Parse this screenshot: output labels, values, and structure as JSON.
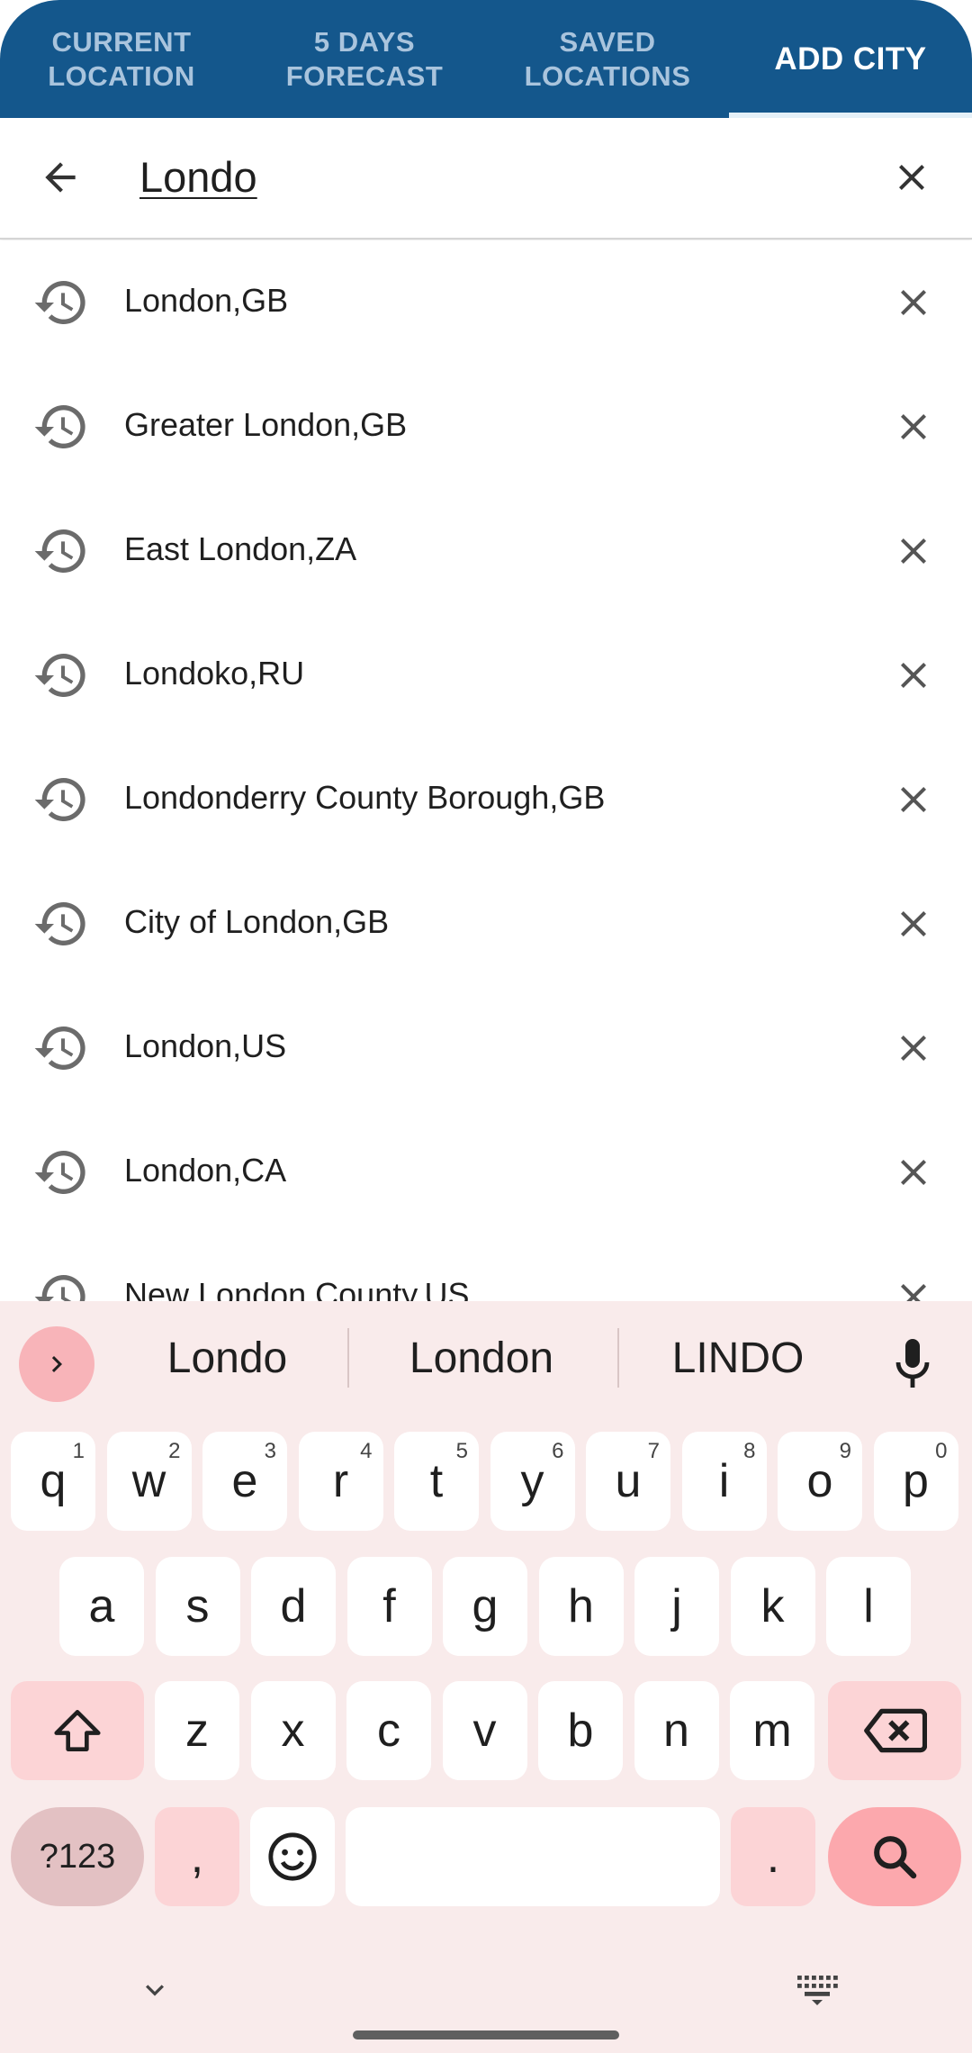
{
  "tabs": [
    {
      "label": "CURRENT\nLOCATION"
    },
    {
      "label": "5 DAYS\nFORECAST"
    },
    {
      "label": "SAVED\nLOCATIONS"
    },
    {
      "label": "ADD CITY"
    }
  ],
  "search": {
    "query": "Londo"
  },
  "suggestions": [
    {
      "label": "London,GB"
    },
    {
      "label": "Greater London,GB"
    },
    {
      "label": "East London,ZA"
    },
    {
      "label": "Londoko,RU"
    },
    {
      "label": "Londonderry County Borough,GB"
    },
    {
      "label": "City of London,GB"
    },
    {
      "label": "London,US"
    },
    {
      "label": "London,CA"
    },
    {
      "label": "New London County,US"
    }
  ],
  "keyboard": {
    "suggestions": [
      "Londo",
      "London",
      "LINDO"
    ],
    "row1": [
      {
        "k": "q",
        "h": "1"
      },
      {
        "k": "w",
        "h": "2"
      },
      {
        "k": "e",
        "h": "3"
      },
      {
        "k": "r",
        "h": "4"
      },
      {
        "k": "t",
        "h": "5"
      },
      {
        "k": "y",
        "h": "6"
      },
      {
        "k": "u",
        "h": "7"
      },
      {
        "k": "i",
        "h": "8"
      },
      {
        "k": "o",
        "h": "9"
      },
      {
        "k": "p",
        "h": "0"
      }
    ],
    "row2": [
      "a",
      "s",
      "d",
      "f",
      "g",
      "h",
      "j",
      "k",
      "l"
    ],
    "row3": [
      "z",
      "x",
      "c",
      "v",
      "b",
      "n",
      "m"
    ],
    "symbols_label": "?123",
    "comma": ",",
    "period": "."
  },
  "colors": {
    "tabbar": "#14578c",
    "tab_inactive_text": "#a9c4dd",
    "keyboard_bg": "#f9ebeb",
    "search_key": "#fca8ad"
  }
}
